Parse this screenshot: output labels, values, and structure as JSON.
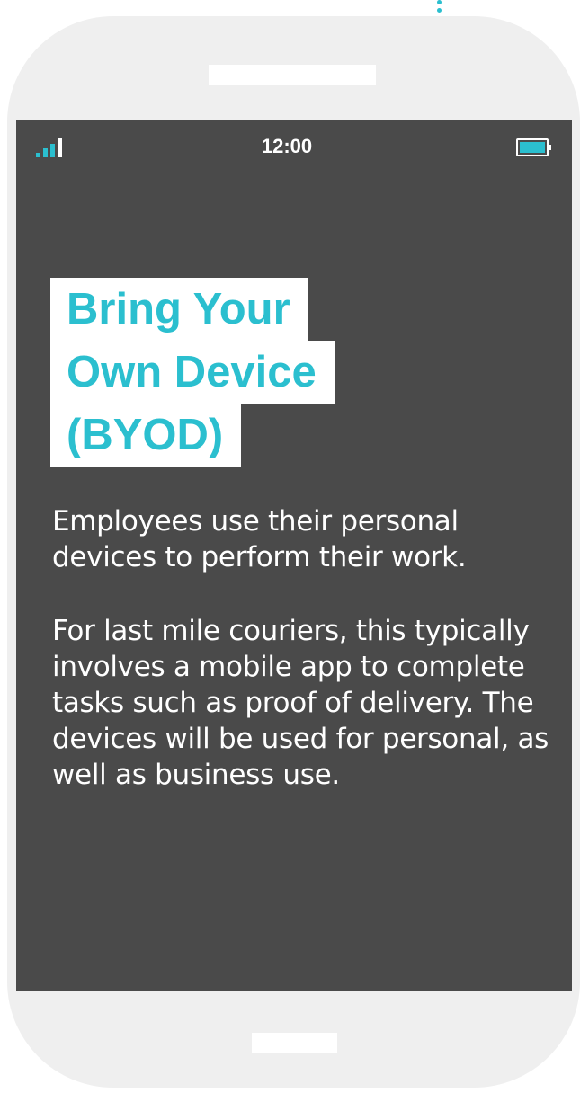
{
  "phone": {
    "status_bar": {
      "time": "12:00",
      "signal_icon": "signal-bars-icon",
      "battery_icon": "battery-icon"
    }
  },
  "content": {
    "title_lines": [
      "Bring Your",
      "Own Device",
      "(BYOD)"
    ],
    "paragraphs": [
      "Employees use their personal devices to perform their work.",
      "For last mile couriers, this typically involves a mobile app to complete tasks such as proof of delivery. The devices will be used for personal, as well as business use."
    ]
  },
  "colors": {
    "accent": "#2bbfcf",
    "screen_background": "#4a4a4a",
    "phone_body": "#efefef",
    "text": "#ffffff"
  }
}
